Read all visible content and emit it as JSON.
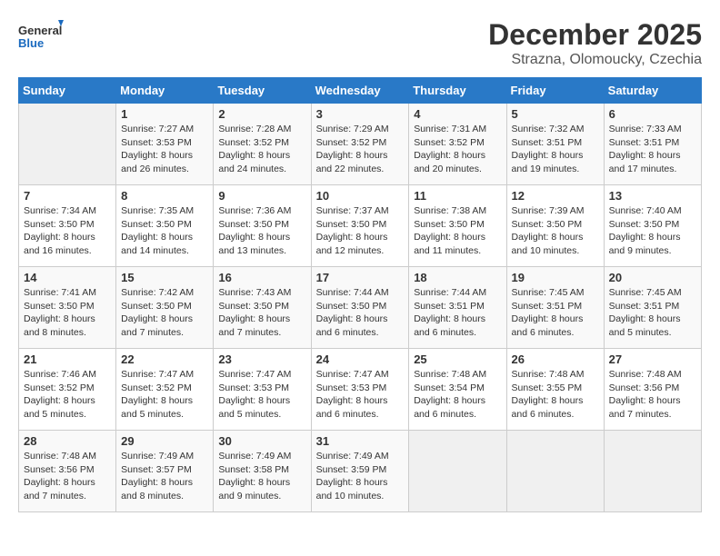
{
  "logo": {
    "line1": "General",
    "line2": "Blue"
  },
  "title": "December 2025",
  "subtitle": "Strazna, Olomoucky, Czechia",
  "weekdays": [
    "Sunday",
    "Monday",
    "Tuesday",
    "Wednesday",
    "Thursday",
    "Friday",
    "Saturday"
  ],
  "weeks": [
    [
      {
        "day": null,
        "info": null
      },
      {
        "day": "1",
        "sunrise": "7:27 AM",
        "sunset": "3:53 PM",
        "daylight": "8 hours and 26 minutes."
      },
      {
        "day": "2",
        "sunrise": "7:28 AM",
        "sunset": "3:52 PM",
        "daylight": "8 hours and 24 minutes."
      },
      {
        "day": "3",
        "sunrise": "7:29 AM",
        "sunset": "3:52 PM",
        "daylight": "8 hours and 22 minutes."
      },
      {
        "day": "4",
        "sunrise": "7:31 AM",
        "sunset": "3:52 PM",
        "daylight": "8 hours and 20 minutes."
      },
      {
        "day": "5",
        "sunrise": "7:32 AM",
        "sunset": "3:51 PM",
        "daylight": "8 hours and 19 minutes."
      },
      {
        "day": "6",
        "sunrise": "7:33 AM",
        "sunset": "3:51 PM",
        "daylight": "8 hours and 17 minutes."
      }
    ],
    [
      {
        "day": "7",
        "sunrise": "7:34 AM",
        "sunset": "3:50 PM",
        "daylight": "8 hours and 16 minutes."
      },
      {
        "day": "8",
        "sunrise": "7:35 AM",
        "sunset": "3:50 PM",
        "daylight": "8 hours and 14 minutes."
      },
      {
        "day": "9",
        "sunrise": "7:36 AM",
        "sunset": "3:50 PM",
        "daylight": "8 hours and 13 minutes."
      },
      {
        "day": "10",
        "sunrise": "7:37 AM",
        "sunset": "3:50 PM",
        "daylight": "8 hours and 12 minutes."
      },
      {
        "day": "11",
        "sunrise": "7:38 AM",
        "sunset": "3:50 PM",
        "daylight": "8 hours and 11 minutes."
      },
      {
        "day": "12",
        "sunrise": "7:39 AM",
        "sunset": "3:50 PM",
        "daylight": "8 hours and 10 minutes."
      },
      {
        "day": "13",
        "sunrise": "7:40 AM",
        "sunset": "3:50 PM",
        "daylight": "8 hours and 9 minutes."
      }
    ],
    [
      {
        "day": "14",
        "sunrise": "7:41 AM",
        "sunset": "3:50 PM",
        "daylight": "8 hours and 8 minutes."
      },
      {
        "day": "15",
        "sunrise": "7:42 AM",
        "sunset": "3:50 PM",
        "daylight": "8 hours and 7 minutes."
      },
      {
        "day": "16",
        "sunrise": "7:43 AM",
        "sunset": "3:50 PM",
        "daylight": "8 hours and 7 minutes."
      },
      {
        "day": "17",
        "sunrise": "7:44 AM",
        "sunset": "3:50 PM",
        "daylight": "8 hours and 6 minutes."
      },
      {
        "day": "18",
        "sunrise": "7:44 AM",
        "sunset": "3:51 PM",
        "daylight": "8 hours and 6 minutes."
      },
      {
        "day": "19",
        "sunrise": "7:45 AM",
        "sunset": "3:51 PM",
        "daylight": "8 hours and 6 minutes."
      },
      {
        "day": "20",
        "sunrise": "7:45 AM",
        "sunset": "3:51 PM",
        "daylight": "8 hours and 5 minutes."
      }
    ],
    [
      {
        "day": "21",
        "sunrise": "7:46 AM",
        "sunset": "3:52 PM",
        "daylight": "8 hours and 5 minutes."
      },
      {
        "day": "22",
        "sunrise": "7:47 AM",
        "sunset": "3:52 PM",
        "daylight": "8 hours and 5 minutes."
      },
      {
        "day": "23",
        "sunrise": "7:47 AM",
        "sunset": "3:53 PM",
        "daylight": "8 hours and 5 minutes."
      },
      {
        "day": "24",
        "sunrise": "7:47 AM",
        "sunset": "3:53 PM",
        "daylight": "8 hours and 6 minutes."
      },
      {
        "day": "25",
        "sunrise": "7:48 AM",
        "sunset": "3:54 PM",
        "daylight": "8 hours and 6 minutes."
      },
      {
        "day": "26",
        "sunrise": "7:48 AM",
        "sunset": "3:55 PM",
        "daylight": "8 hours and 6 minutes."
      },
      {
        "day": "27",
        "sunrise": "7:48 AM",
        "sunset": "3:56 PM",
        "daylight": "8 hours and 7 minutes."
      }
    ],
    [
      {
        "day": "28",
        "sunrise": "7:48 AM",
        "sunset": "3:56 PM",
        "daylight": "8 hours and 7 minutes."
      },
      {
        "day": "29",
        "sunrise": "7:49 AM",
        "sunset": "3:57 PM",
        "daylight": "8 hours and 8 minutes."
      },
      {
        "day": "30",
        "sunrise": "7:49 AM",
        "sunset": "3:58 PM",
        "daylight": "8 hours and 9 minutes."
      },
      {
        "day": "31",
        "sunrise": "7:49 AM",
        "sunset": "3:59 PM",
        "daylight": "8 hours and 10 minutes."
      },
      {
        "day": null,
        "info": null
      },
      {
        "day": null,
        "info": null
      },
      {
        "day": null,
        "info": null
      }
    ]
  ]
}
